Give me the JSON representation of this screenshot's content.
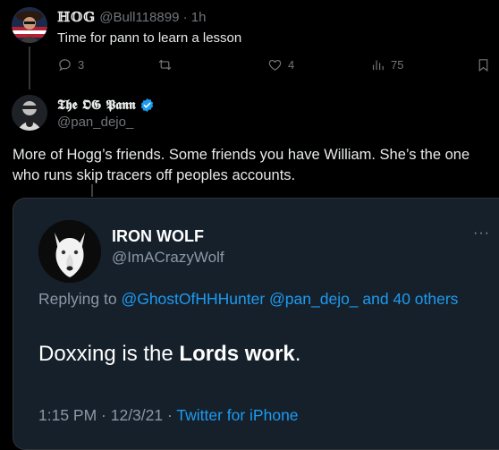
{
  "parent_tweet": {
    "display_name": "ℍ𝕆𝔾",
    "handle": "@Bull118899",
    "separator": "·",
    "time": "1h",
    "text": "Time for pann to learn a lesson",
    "actions": {
      "reply_count": "3",
      "like_count": "4",
      "views_count": "75"
    }
  },
  "main_tweet": {
    "display_name": "𝕿𝖍𝖊 𝕺𝕲 𝕻𝖆𝖓𝖓",
    "handle": "@pan_dejo_",
    "text": "More of Hogg’s friends. Some friends you have William. She’s the one who runs skip tracers off peoples accounts."
  },
  "embedded_card": {
    "display_name": "IRON WOLF",
    "handle": "@ImACrazyWolf",
    "more": "···",
    "replying_prefix": "Replying to",
    "replying_mentions": "@GhostOfHHHunter @pan_dejo_ and 40 others",
    "text_prefix": "Doxxing is the ",
    "text_bold": "Lords work",
    "text_suffix": ".",
    "timestamp": "1:15 PM · 12/3/21 · ",
    "source": "Twitter for iPhone"
  },
  "colors": {
    "background": "#000000",
    "text_primary": "#e7e9ea",
    "text_secondary": "#71767b",
    "link_blue": "#1d9bf0",
    "card_background": "#15202b",
    "verified_blue": "#1d9bf0"
  }
}
